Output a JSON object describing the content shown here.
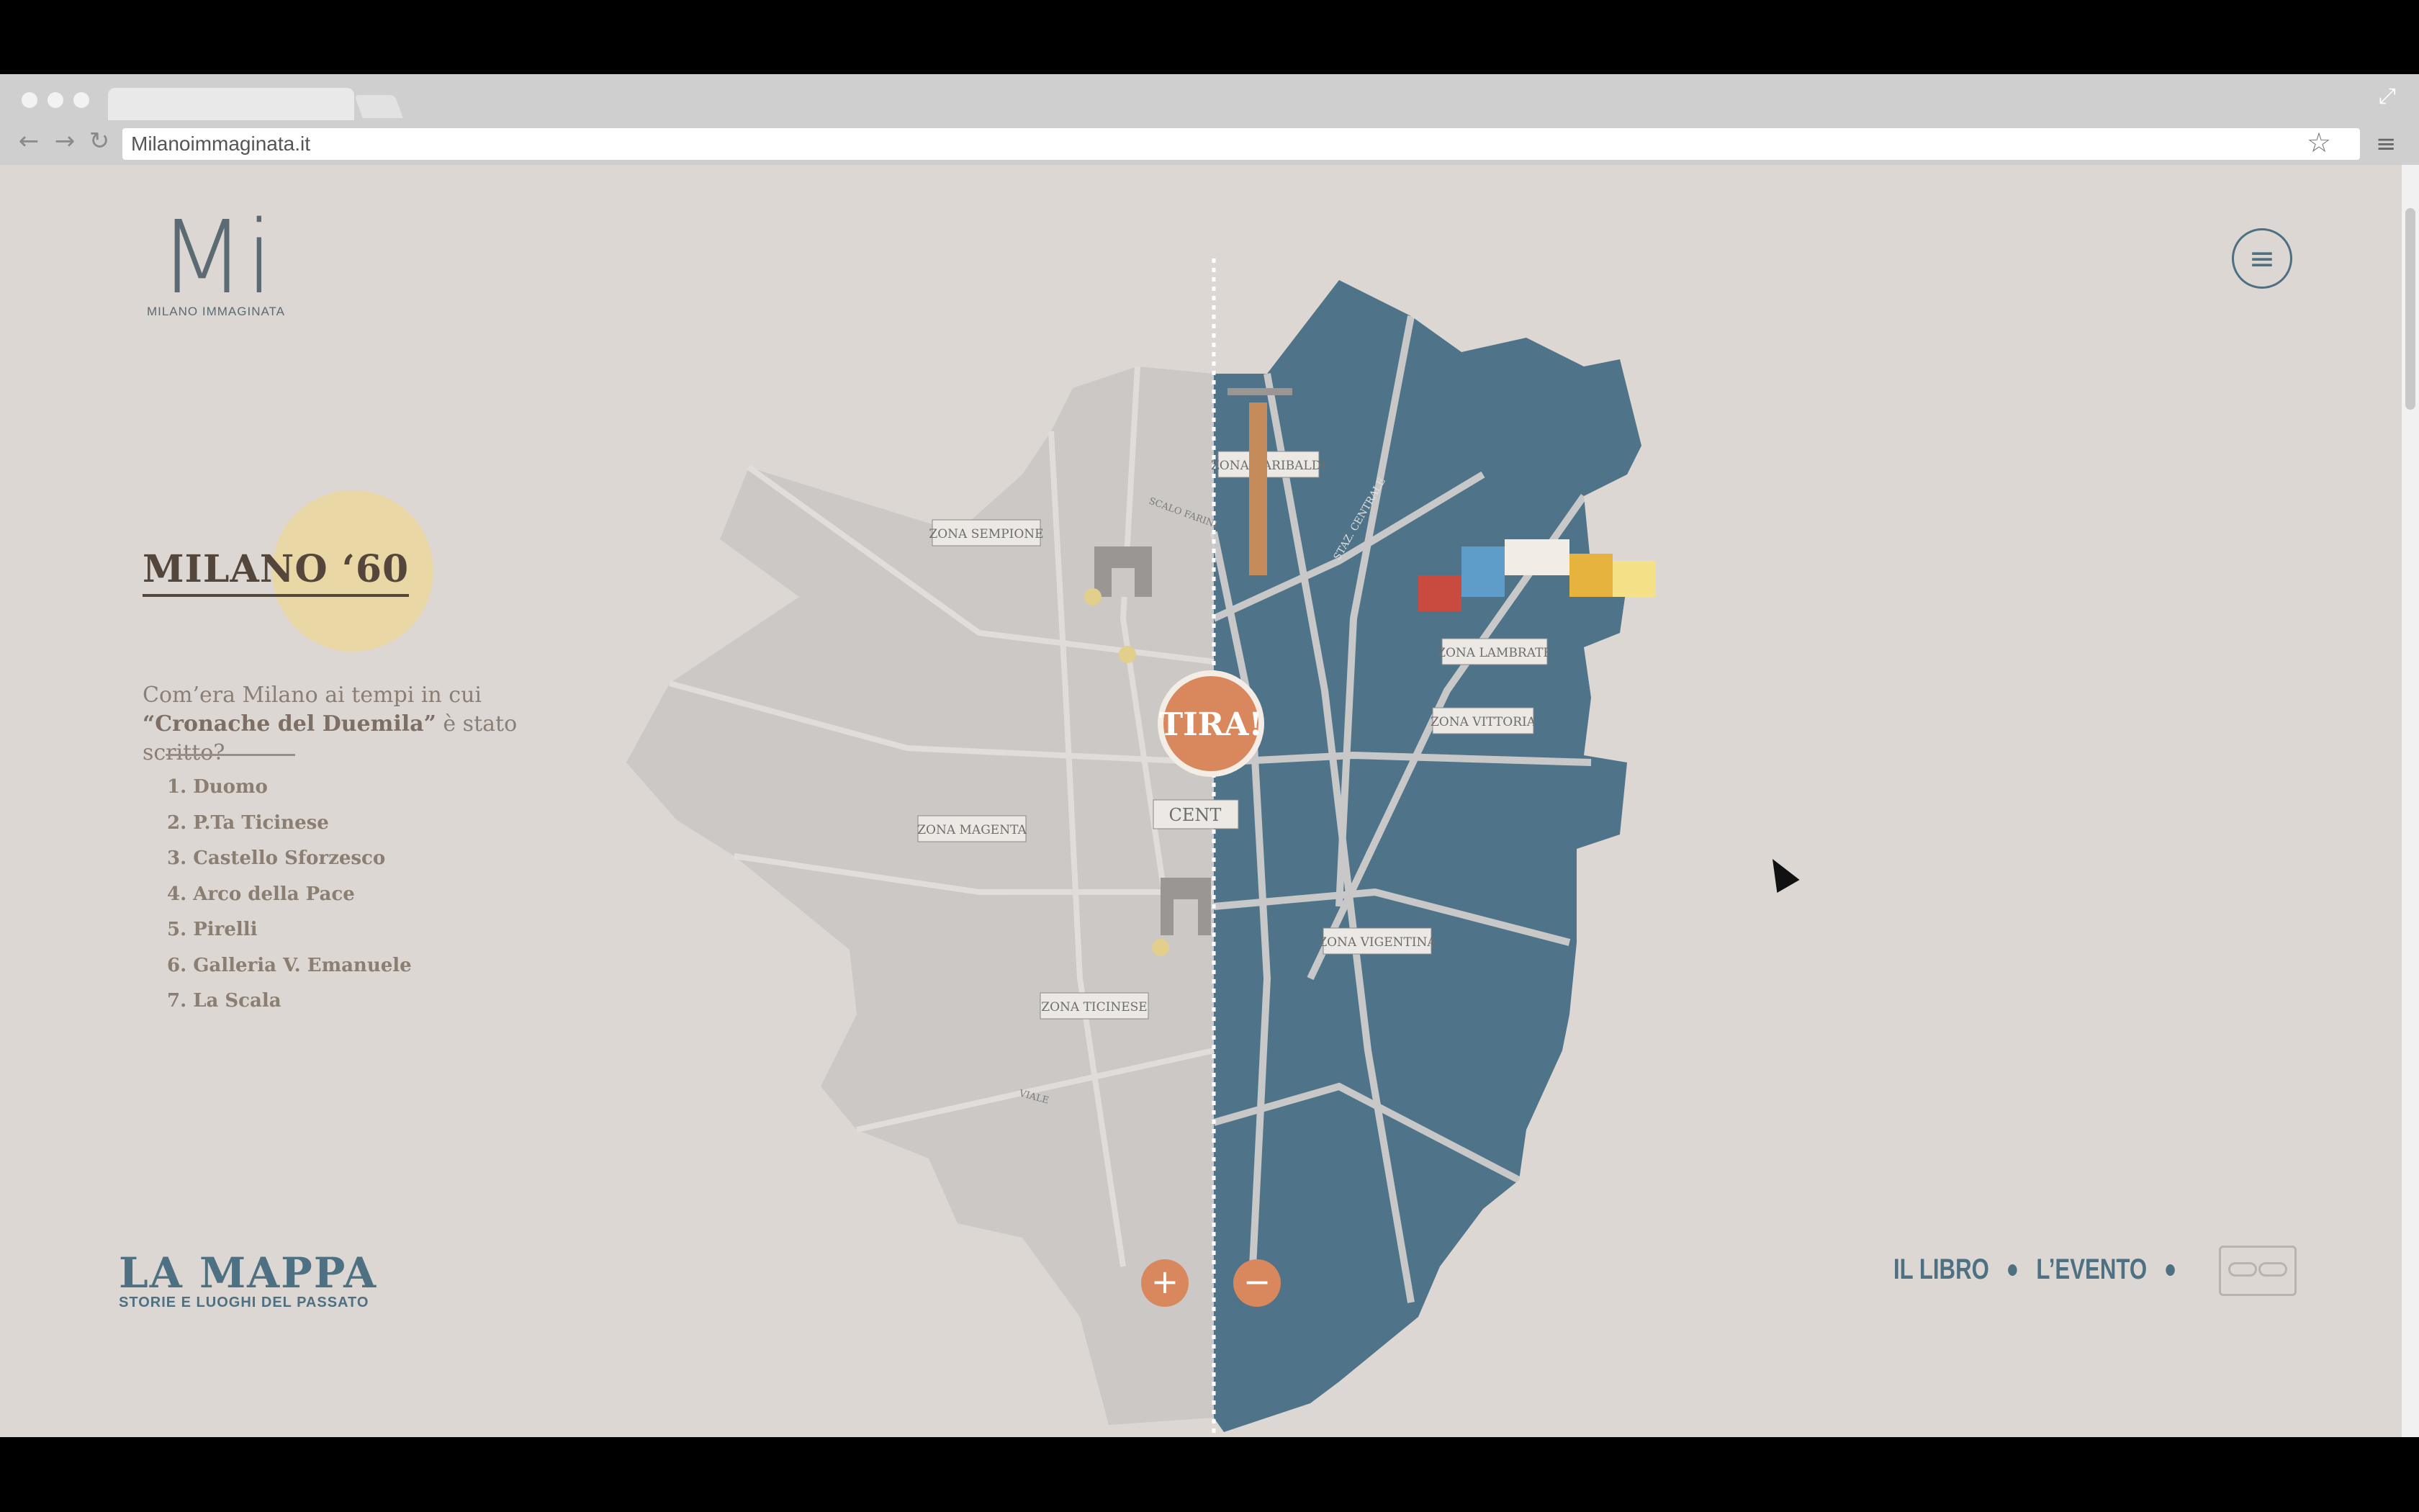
{
  "browser": {
    "url": "Milanoimmaginata.it",
    "back_icon": "←",
    "forward_icon": "→",
    "reload_icon": "↻",
    "star_icon": "☆",
    "menu_icon": "≡",
    "expand_icon": "⤢"
  },
  "brand": {
    "logo_mark": "Mi",
    "logo_name": "MILANO IMMAGINATA"
  },
  "sidebar": {
    "title": "MILANO ‘60",
    "intro_prefix": "Com’era Milano ai tempi in cui ",
    "intro_bold": "“Cronache del Duemila”",
    "intro_suffix": " è stato scritto?",
    "items": [
      "1. Duomo",
      "2. P.Ta Ticinese",
      "3. Castello Sforzesco",
      "4. Arco della Pace",
      "5. Pirelli",
      "6. Galleria V. Emanuele",
      "7. La Scala"
    ]
  },
  "map": {
    "tira_label": "TIRA!",
    "zones": {
      "sempione": "ZONA SEMPIONE",
      "magenta": "ZONA MAGENTA",
      "ticinese": "ZONA TICINESE",
      "garibaldi": "ZONA GARIBALDI",
      "lambrate": "ZONA LAMBRATE",
      "vittoria": "ZONA VITTORIA",
      "vigentina": "ZONA VIGENTINA",
      "centro": "CENT"
    },
    "street_labels": {
      "scalo": "SCALO FARINI",
      "staz": "STAZ. CENTRALE",
      "via": "VIALE"
    },
    "colors": {
      "old_map": "#cbc8c5",
      "new_map": "#4f7389",
      "accent": "#d9875c"
    }
  },
  "footer": {
    "mappa_title": "LA MAPPA",
    "mappa_subtitle": "STORIE E LUOGHI DEL PASSATO",
    "nav_libro": "IL LIBRO",
    "nav_evento": "L’EVENTO",
    "zoom_in": "+",
    "zoom_out": "−"
  }
}
